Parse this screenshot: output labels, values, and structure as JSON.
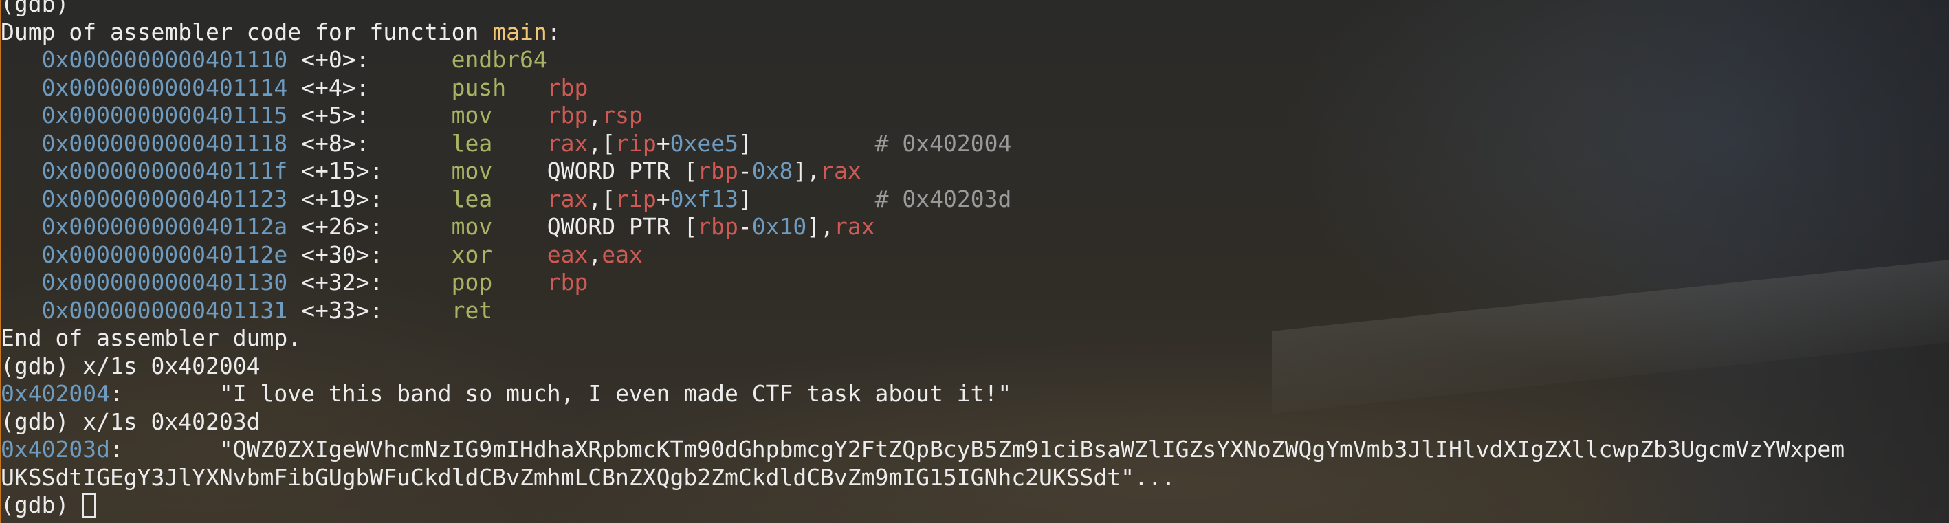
{
  "terminal": {
    "prev_line": "(gdb)",
    "dump_header_prefix": "Dump of assembler code for function ",
    "function_name": "main",
    "dump_header_suffix": ":",
    "instructions": [
      {
        "addr": "0x0000000000401110",
        "offset": "<+0>:",
        "mnemonic": "endbr64",
        "operands": []
      },
      {
        "addr": "0x0000000000401114",
        "offset": "<+4>:",
        "mnemonic": "push",
        "operands": [
          [
            "reg",
            "rbp"
          ]
        ]
      },
      {
        "addr": "0x0000000000401115",
        "offset": "<+5>:",
        "mnemonic": "mov",
        "operands": [
          [
            "reg",
            "rbp"
          ],
          [
            "plain",
            ","
          ],
          [
            "reg",
            "rsp"
          ]
        ]
      },
      {
        "addr": "0x0000000000401118",
        "offset": "<+8>:",
        "mnemonic": "lea",
        "operands": [
          [
            "reg",
            "rax"
          ],
          [
            "plain",
            ",["
          ],
          [
            "reg",
            "rip"
          ],
          [
            "plain",
            "+"
          ],
          [
            "num",
            "0xee5"
          ],
          [
            "plain",
            "]"
          ]
        ],
        "comment": "# 0x402004"
      },
      {
        "addr": "0x000000000040111f",
        "offset": "<+15>:",
        "mnemonic": "mov",
        "operands": [
          [
            "plain",
            "QWORD PTR ["
          ],
          [
            "reg",
            "rbp"
          ],
          [
            "plain",
            "-"
          ],
          [
            "num",
            "0x8"
          ],
          [
            "plain",
            "],"
          ],
          [
            "reg",
            "rax"
          ]
        ]
      },
      {
        "addr": "0x0000000000401123",
        "offset": "<+19>:",
        "mnemonic": "lea",
        "operands": [
          [
            "reg",
            "rax"
          ],
          [
            "plain",
            ",["
          ],
          [
            "reg",
            "rip"
          ],
          [
            "plain",
            "+"
          ],
          [
            "num",
            "0xf13"
          ],
          [
            "plain",
            "]"
          ]
        ],
        "comment": "# 0x40203d"
      },
      {
        "addr": "0x000000000040112a",
        "offset": "<+26>:",
        "mnemonic": "mov",
        "operands": [
          [
            "plain",
            "QWORD PTR ["
          ],
          [
            "reg",
            "rbp"
          ],
          [
            "plain",
            "-"
          ],
          [
            "num",
            "0x10"
          ],
          [
            "plain",
            "],"
          ],
          [
            "reg",
            "rax"
          ]
        ]
      },
      {
        "addr": "0x000000000040112e",
        "offset": "<+30>:",
        "mnemonic": "xor",
        "operands": [
          [
            "reg",
            "eax"
          ],
          [
            "plain",
            ","
          ],
          [
            "reg",
            "eax"
          ]
        ]
      },
      {
        "addr": "0x0000000000401130",
        "offset": "<+32>:",
        "mnemonic": "pop",
        "operands": [
          [
            "reg",
            "rbp"
          ]
        ]
      },
      {
        "addr": "0x0000000000401131",
        "offset": "<+33>:",
        "mnemonic": "ret",
        "operands": []
      }
    ],
    "dump_footer": "End of assembler dump.",
    "examine": [
      {
        "command": "(gdb) x/1s 0x402004",
        "addr": "0x402004",
        "value": "\"I love this band so much, I even made CTF task about it!\"",
        "continuation": null
      },
      {
        "command": "(gdb) x/1s 0x40203d",
        "addr": "0x40203d",
        "value": "\"QWZ0ZXIgeWVhcmNzIG9mIHdhaXRpbmcKTm90dGhpbmcgY2FtZQpBcyB5Zm91ciBsaWZlIGZsYXNoZWQgYmVmb3JlIHlvdXIgZXllcwpZb3UgcmVzYWxpem",
        "continuation": "UKSSdtIGEgY3JlYXNvbmFibGUgbWFuCkdldCBvZmhmLCBnZXQgb2ZmCkdldCBvZm9mIG15IGNhc2UKSSdt\"..."
      }
    ],
    "prompt": "(gdb) "
  },
  "colors": {
    "address": "#6e9bc0",
    "function_name": "#f0c674",
    "mnemonic": "#a6b464",
    "register": "#cf5a55",
    "immediate": "#6e9bc0",
    "comment": "#9a9a9a",
    "text": "#ececec"
  }
}
